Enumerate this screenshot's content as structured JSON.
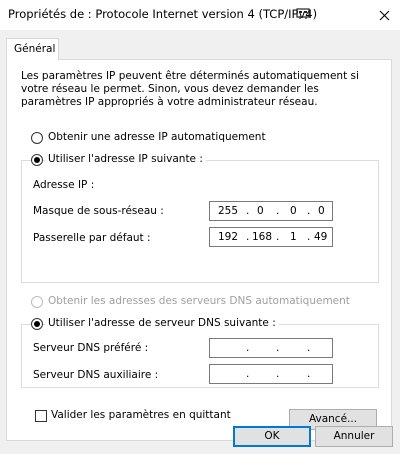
{
  "window": {
    "title": "Propriétés de : Protocole Internet version 4 (TCP/IPv4)",
    "close_glyph": "✕"
  },
  "tabs": [
    {
      "label": "Général"
    }
  ],
  "description": "Les paramètres IP peuvent être déterminés automatiquement si votre réseau le permet. Sinon, vous devez demander les paramètres IP appropriés à votre administrateur réseau.",
  "ip_section": {
    "auto_label": "Obtenir une adresse IP automatiquement",
    "manual_label": "Utiliser l'adresse IP suivante :",
    "fields": {
      "ip_address_label": "Adresse IP :",
      "subnet_label": "Masque de sous-réseau :",
      "subnet_value": [
        "255",
        "0",
        "0",
        "0"
      ],
      "gateway_label": "Passerelle par défaut :",
      "gateway_value": [
        "192",
        "168",
        "1",
        "49"
      ]
    }
  },
  "dns_section": {
    "auto_label": "Obtenir les adresses des serveurs DNS automatiquement",
    "manual_label": "Utiliser l'adresse de serveur DNS suivante :",
    "preferred_label": "Serveur DNS préféré :",
    "alternate_label": "Serveur DNS auxiliaire :",
    "dot": "."
  },
  "validate_label": "Valider les paramètres en quittant",
  "buttons": {
    "advanced": "Avancé...",
    "ok": "OK",
    "cancel": "Annuler"
  },
  "colors": {
    "dialog_bg": "#f0f0f0",
    "accent": "#0078d7",
    "disabled_text": "#a0a0a0"
  }
}
